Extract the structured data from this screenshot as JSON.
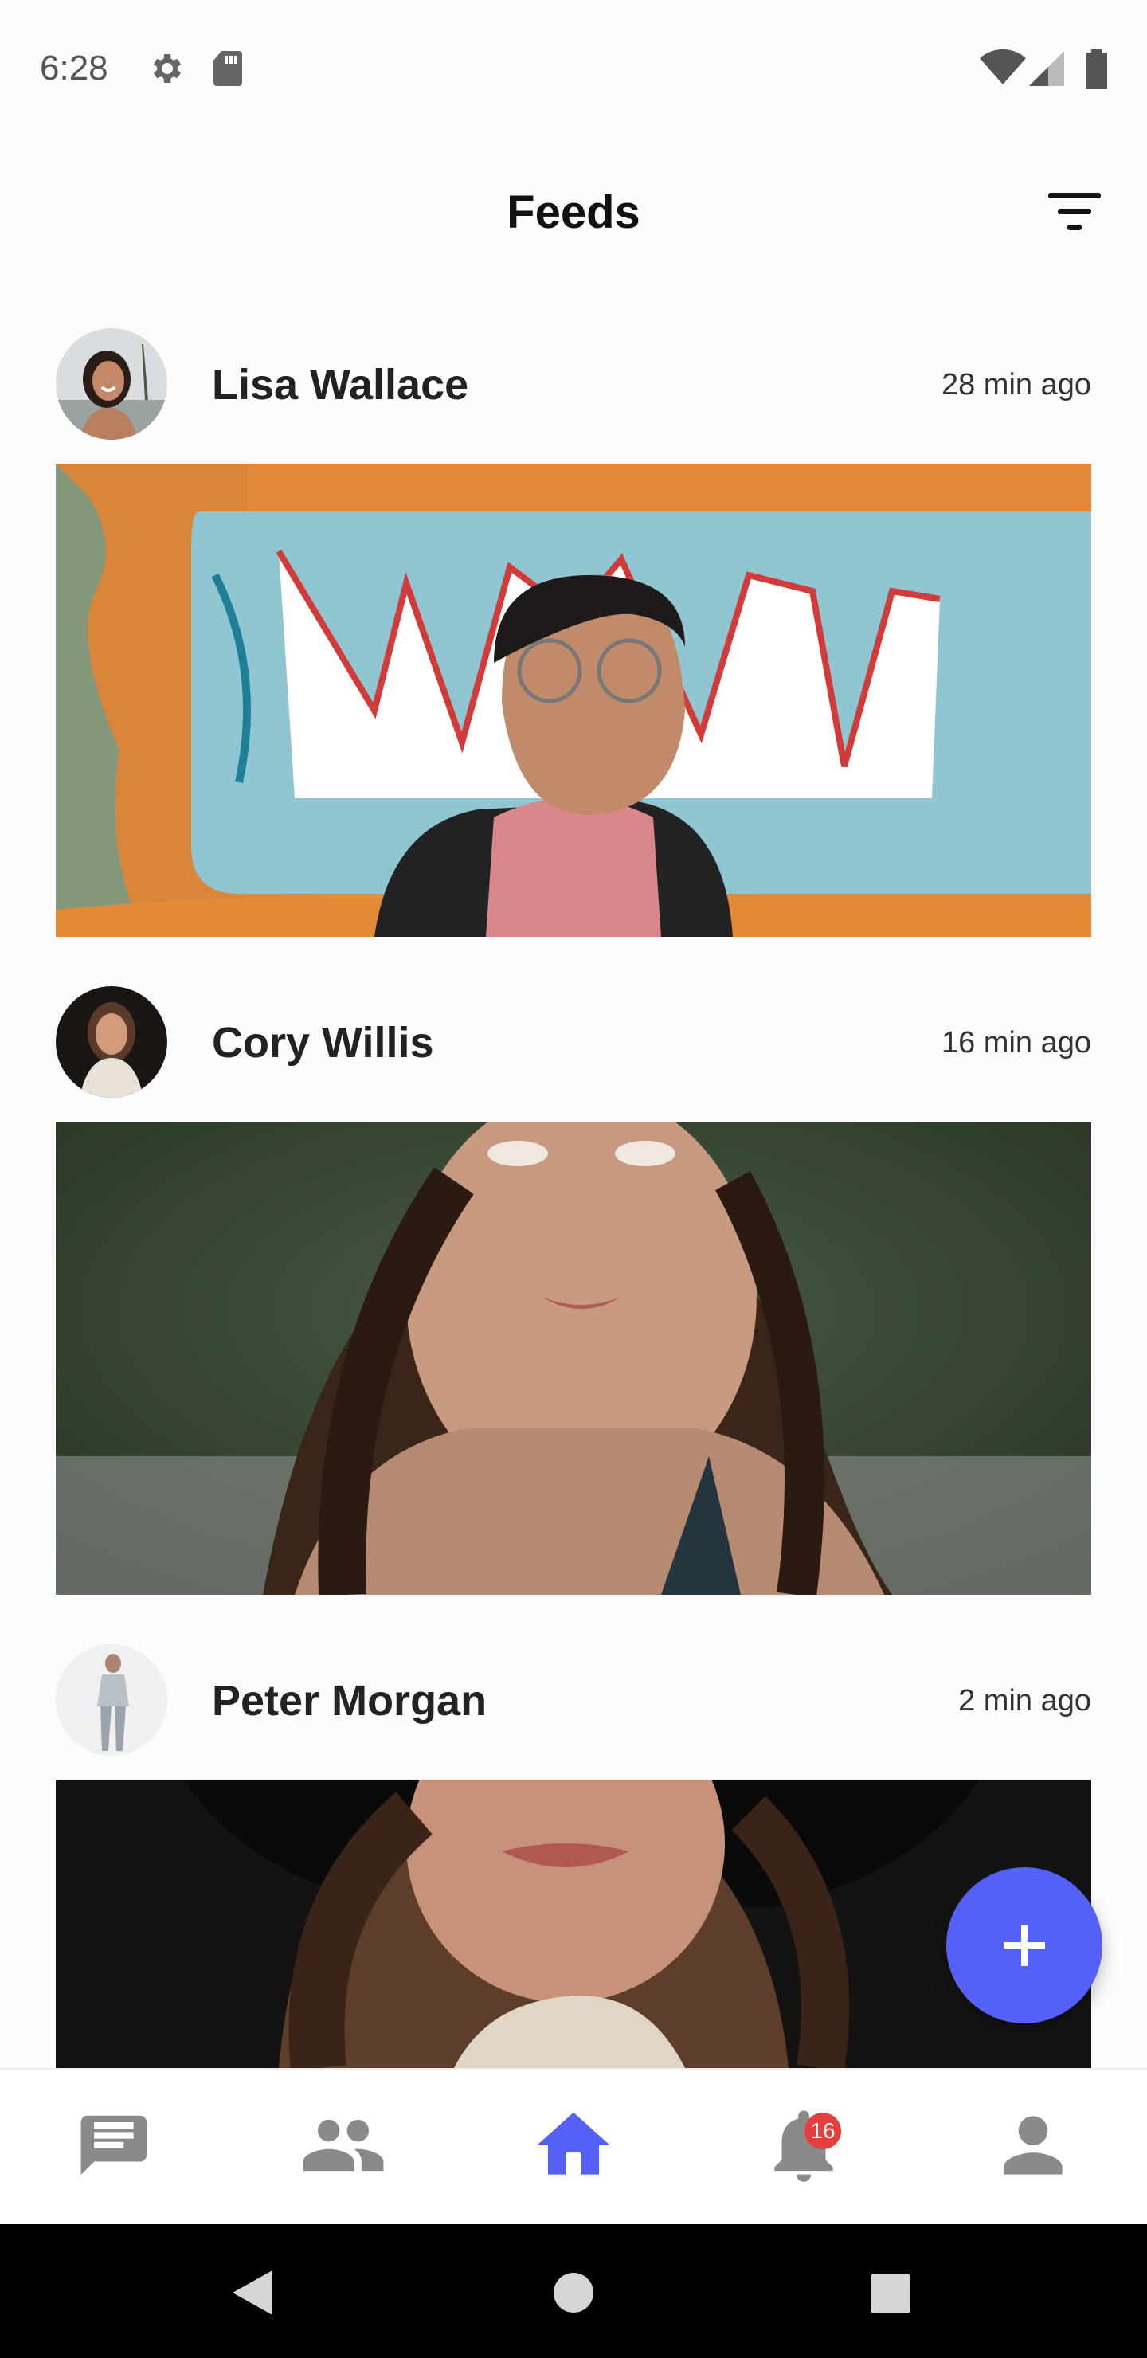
{
  "status_bar": {
    "time": "6:28",
    "icons_left": [
      "gear-icon",
      "sd-card-icon"
    ],
    "icons_right": [
      "wifi-icon",
      "cell-signal-icon",
      "battery-icon"
    ]
  },
  "header": {
    "title": "Feeds",
    "filter_icon": "filter-icon"
  },
  "posts": [
    {
      "author": "Lisa Wallace",
      "time": "28 min ago"
    },
    {
      "author": "Cory Willis",
      "time": "16 min ago"
    },
    {
      "author": "Peter Morgan",
      "time": "2 min ago"
    }
  ],
  "fab": {
    "icon": "plus-icon"
  },
  "bottom_nav": {
    "items": [
      {
        "name": "messages",
        "icon": "chat-icon",
        "active": false
      },
      {
        "name": "friends",
        "icon": "people-icon",
        "active": false
      },
      {
        "name": "home",
        "icon": "home-icon",
        "active": true
      },
      {
        "name": "notifications",
        "icon": "bell-icon",
        "active": false,
        "badge": "16"
      },
      {
        "name": "profile",
        "icon": "person-icon",
        "active": false
      }
    ]
  },
  "colors": {
    "accent": "#5460f7",
    "badge": "#e43e3e",
    "inactive_icon": "#8a8a8a"
  }
}
